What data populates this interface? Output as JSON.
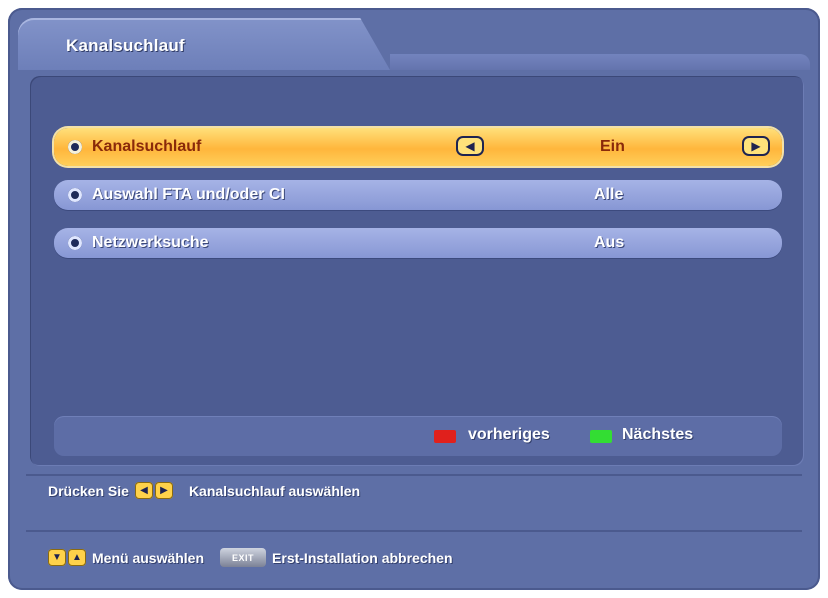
{
  "tab": {
    "title": "Kanalsuchlauf"
  },
  "menu": {
    "items": [
      {
        "label": "Kanalsuchlauf",
        "value": "Ein",
        "selected": true
      },
      {
        "label": "Auswahl FTA und/oder CI",
        "value": "Alle",
        "selected": false
      },
      {
        "label": "Netzwerksuche",
        "value": "Aus",
        "selected": false
      }
    ]
  },
  "keys": {
    "red_label": "vorheriges",
    "green_label": "Nächstes",
    "red_color": "#e0201c",
    "green_color": "#33dd33"
  },
  "help": {
    "line1_prefix": "Drücken Sie",
    "line1_suffix": "Kanalsuchlauf auswählen",
    "line2_text": "Menü auswählen",
    "exit_label": "EXIT",
    "line2_suffix": "Erst-Installation abbrechen"
  },
  "icons": {
    "left_arrow": "◀",
    "right_arrow": "▶",
    "down_arrow": "▼",
    "up_arrow": "▲"
  }
}
